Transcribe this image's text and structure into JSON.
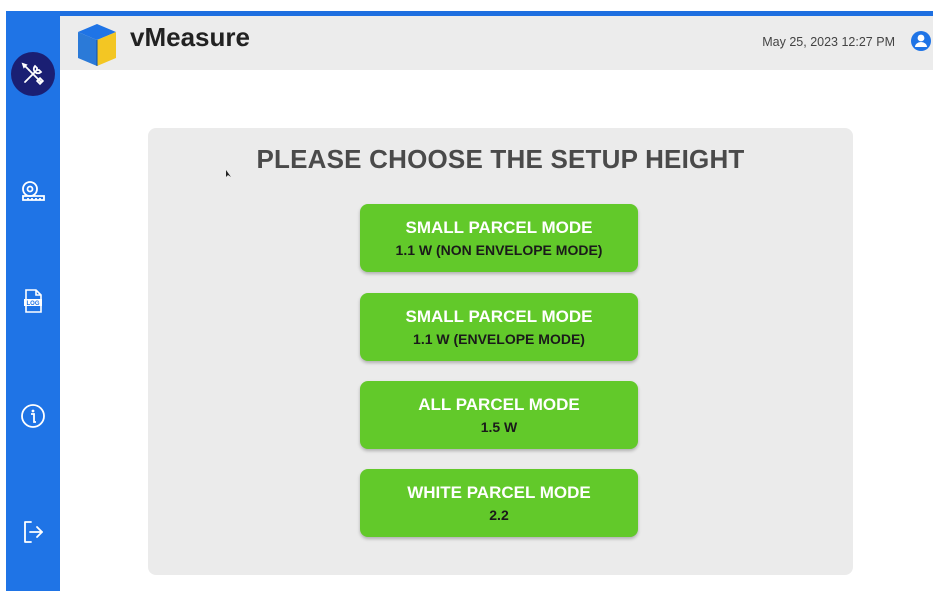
{
  "app": {
    "name": "vMeasure"
  },
  "header": {
    "datetime": "May 25, 2023 12:27 PM"
  },
  "sidebar": {
    "items": [
      {
        "icon": "tools-icon",
        "active": true
      },
      {
        "icon": "tape-measure-icon",
        "active": false
      },
      {
        "icon": "log-file-icon",
        "active": false
      },
      {
        "icon": "info-icon",
        "active": false
      },
      {
        "icon": "logout-icon",
        "active": false
      }
    ]
  },
  "main": {
    "title": "PLEASE CHOOSE THE SETUP HEIGHT",
    "modes": [
      {
        "title": "SMALL PARCEL MODE",
        "subtitle": "1.1 W (NON ENVELOPE MODE)"
      },
      {
        "title": "SMALL PARCEL MODE",
        "subtitle": "1.1 W (ENVELOPE MODE)"
      },
      {
        "title": "ALL PARCEL MODE",
        "subtitle": "1.5 W"
      },
      {
        "title": "WHITE PARCEL MODE",
        "subtitle": "2.2"
      }
    ]
  },
  "colors": {
    "sidebar": "#1f74e6",
    "active_item": "#1a1f73",
    "mode_button": "#62c92a",
    "panel": "#ebebeb",
    "header": "#ececec"
  }
}
